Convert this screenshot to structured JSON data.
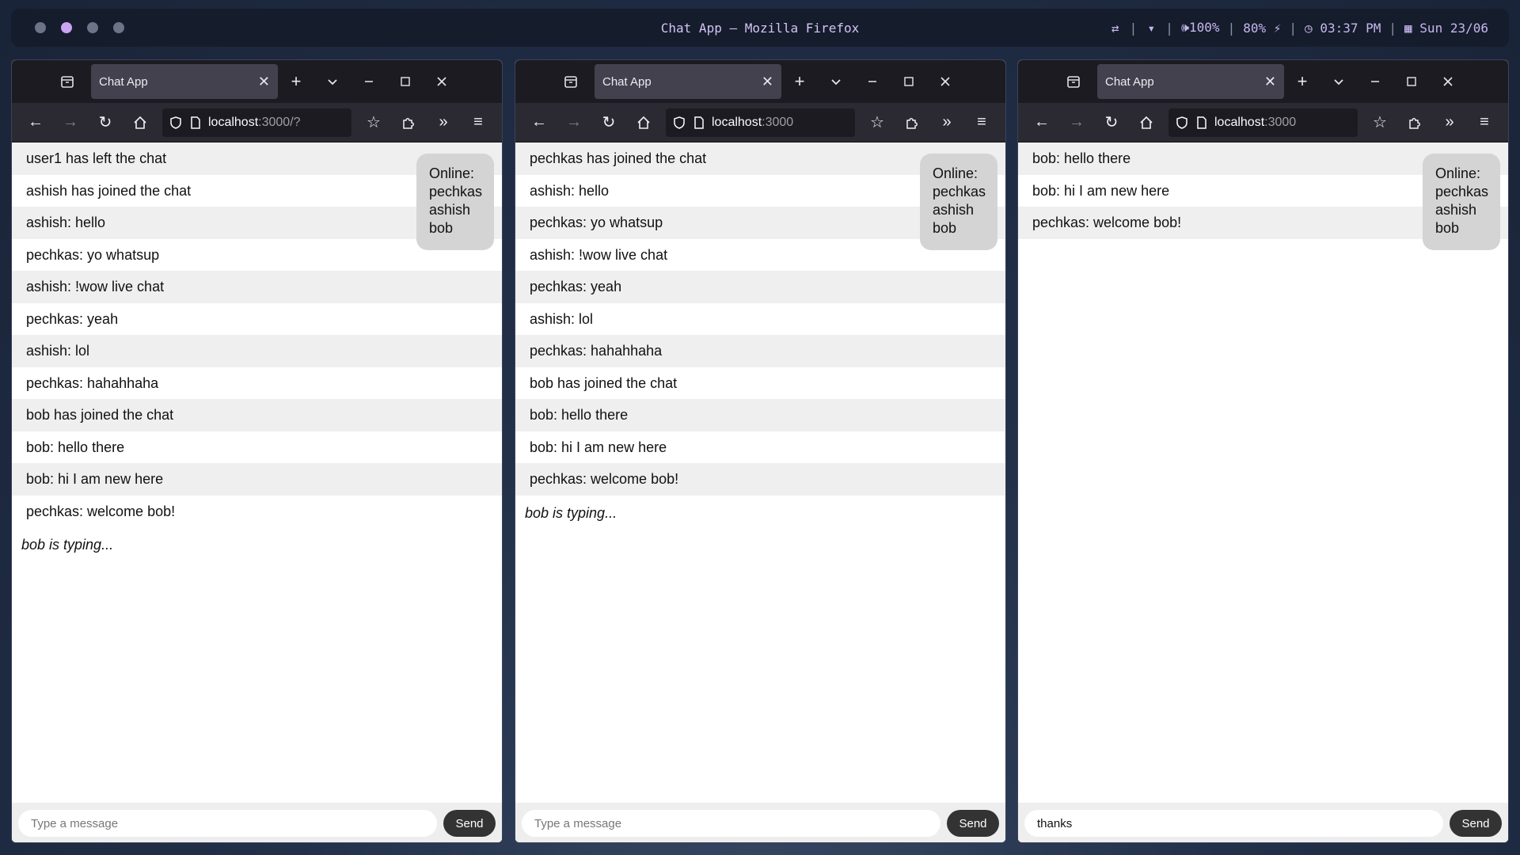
{
  "topbar": {
    "title": "Chat App — Mozilla Firefox",
    "workspaces": 4,
    "active_workspace": 2,
    "sep": "|",
    "volume": "100%",
    "battery": "80%",
    "time": "03:37 PM",
    "date": "Sun 23/06"
  },
  "windows": [
    {
      "tab_title": "Chat App",
      "url_host": "localhost",
      "url_rest": ":3000/?",
      "messages": [
        "user1 has left the chat",
        "ashish has joined the chat",
        "ashish: hello",
        "pechkas: yo whatsup",
        "ashish: !wow live chat",
        "pechkas: yeah",
        "ashish: lol",
        "pechkas: hahahhaha",
        "bob has joined the chat",
        "bob: hello there",
        "bob: hi I am new here",
        "pechkas: welcome bob!"
      ],
      "typing": "bob is typing...",
      "online_label": "Online:",
      "online_users": [
        "pechkas",
        "ashish",
        "bob"
      ],
      "input_placeholder": "Type a message",
      "input_value": "",
      "send_label": "Send"
    },
    {
      "tab_title": "Chat App",
      "url_host": "localhost",
      "url_rest": ":3000",
      "messages": [
        "pechkas has joined the chat",
        "ashish: hello",
        "pechkas: yo whatsup",
        "ashish: !wow live chat",
        "pechkas: yeah",
        "ashish: lol",
        "pechkas: hahahhaha",
        "bob has joined the chat",
        "bob: hello there",
        "bob: hi I am new here",
        "pechkas: welcome bob!"
      ],
      "typing": "bob is typing...",
      "online_label": "Online:",
      "online_users": [
        "pechkas",
        "ashish",
        "bob"
      ],
      "input_placeholder": "Type a message",
      "input_value": "",
      "send_label": "Send"
    },
    {
      "tab_title": "Chat App",
      "url_host": "localhost",
      "url_rest": ":3000",
      "messages": [
        "bob: hello there",
        "bob: hi I am new here",
        "pechkas: welcome bob!"
      ],
      "typing": "",
      "online_label": "Online:",
      "online_users": [
        "pechkas",
        "ashish",
        "bob"
      ],
      "input_placeholder": "Type a message",
      "input_value": "thanks",
      "send_label": "Send"
    }
  ]
}
